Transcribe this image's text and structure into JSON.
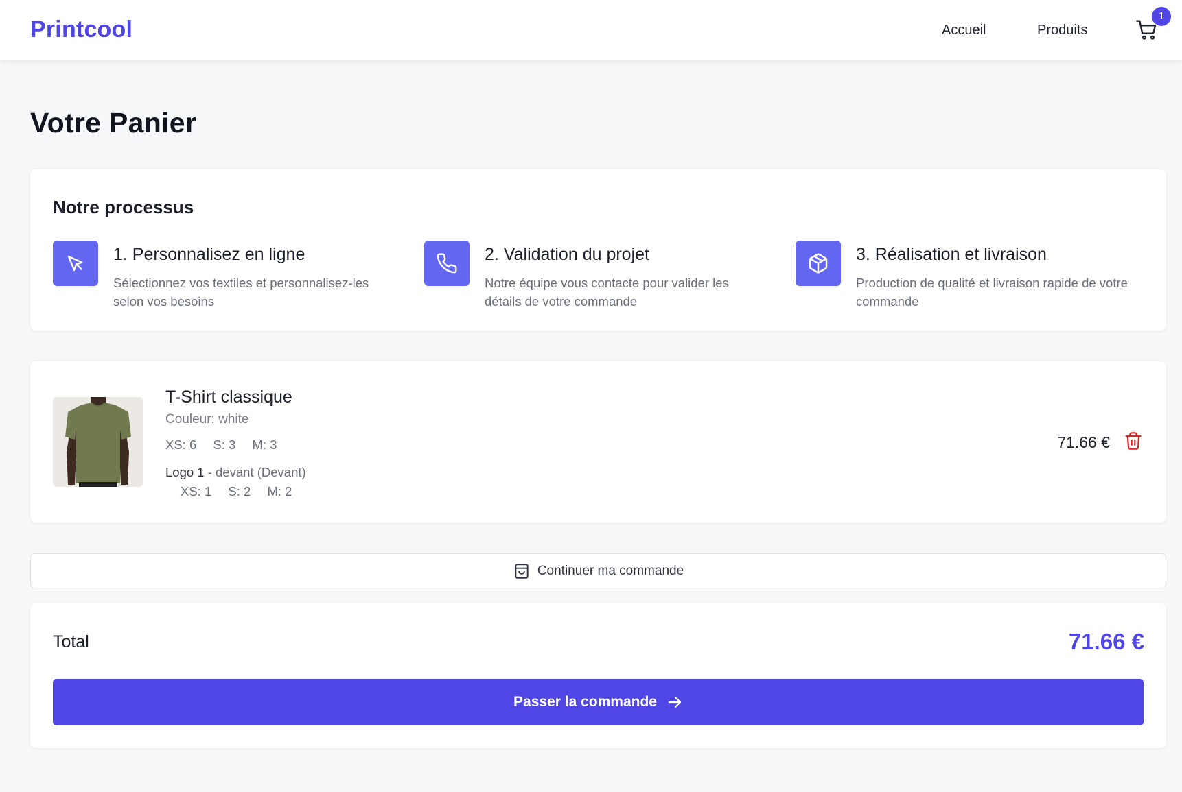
{
  "header": {
    "brand": "Printcool",
    "nav": {
      "home": "Accueil",
      "products": "Produits"
    },
    "cart": {
      "icon": "cart-icon",
      "count": "1"
    }
  },
  "page": {
    "title": "Votre Panier"
  },
  "process": {
    "title": "Notre processus",
    "accent": "#6366f1",
    "steps": [
      {
        "icon": "cursor-icon",
        "title": "1. Personnalisez en ligne",
        "description": "Sélectionnez vos textiles et personnalisez-les selon vos besoins"
      },
      {
        "icon": "phone-icon",
        "title": "2. Validation du projet",
        "description": "Notre équipe vous contacte pour valider les détails de votre commande"
      },
      {
        "icon": "box-icon",
        "title": "3. Réalisation et livraison",
        "description": "Production de qualité et livraison rapide de votre commande"
      }
    ]
  },
  "cart_items": [
    {
      "name": "T-Shirt classique",
      "color_line": "Couleur: white",
      "sizes": [
        "XS: 6",
        "S: 3",
        "M: 3"
      ],
      "logo": {
        "name": "Logo 1",
        "placement": " - devant (Devant)",
        "sizes": [
          "XS: 1",
          "S: 2",
          "M: 2"
        ]
      },
      "price": "71.66 €",
      "delete_icon": "trash-icon",
      "delete_color": "#dc2626"
    }
  ],
  "actions": {
    "continue_label": "Continuer ma commande",
    "continue_icon": "shopping-bag-icon",
    "checkout_label": "Passer la commande",
    "checkout_icon": "arrow-right-icon"
  },
  "summary": {
    "total_label": "Total",
    "total_value": "71.66 €"
  },
  "colors": {
    "primary": "#4f46e5",
    "background": "#f7f8fa",
    "card": "#ffffff"
  }
}
